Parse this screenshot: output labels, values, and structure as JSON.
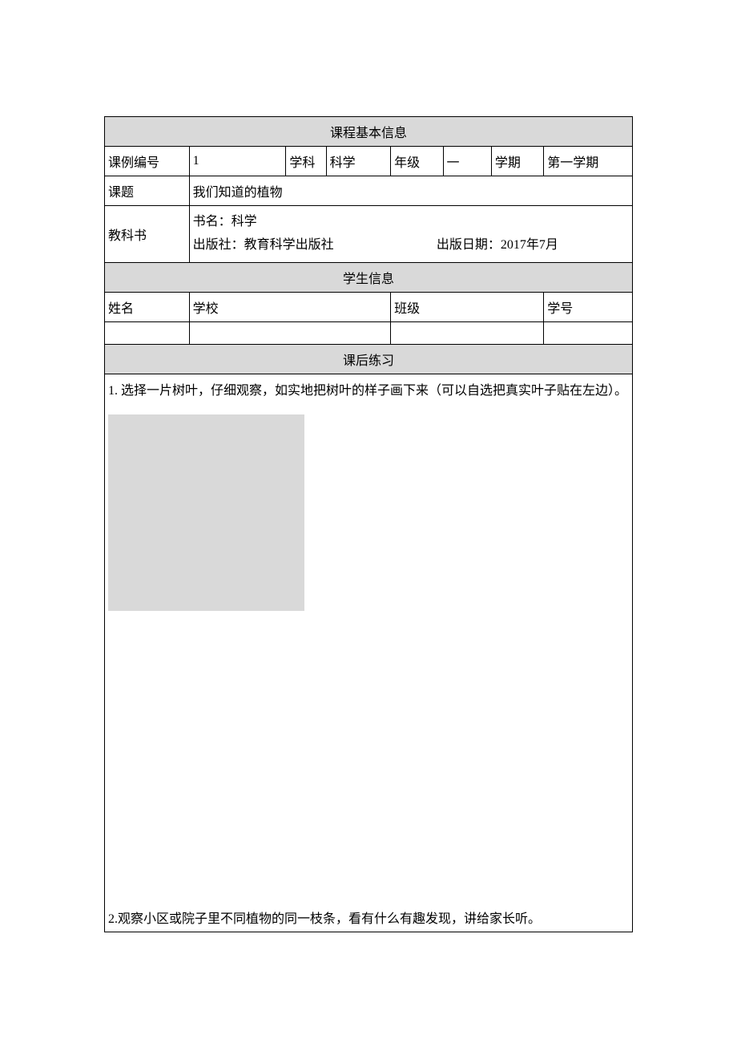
{
  "sections": {
    "course_info": "课程基本信息",
    "student_info": "学生信息",
    "exercise": "课后练习"
  },
  "course": {
    "id_label": "课例编号",
    "id_value": "1",
    "subject_label": "学科",
    "subject_value": "科学",
    "grade_label": "年级",
    "grade_value": "一",
    "term_label": "学期",
    "term_value": "第一学期",
    "topic_label": "课题",
    "topic_value": "我们知道的植物",
    "textbook_label": "教科书",
    "textbook_name": "书名：科学",
    "textbook_publisher": "出版社：教育科学出版社",
    "textbook_date": "出版日期：2017年7月"
  },
  "student": {
    "name_label": "姓名",
    "school_label": "学校",
    "class_label": "班级",
    "number_label": "学号"
  },
  "exercise": {
    "q1": "1. 选择一片树叶，仔细观察，如实地把树叶的样子画下来（可以自选把真实叶子贴在左边）。",
    "q2": "2.观察小区或院子里不同植物的同一枝条，看有什么有趣发现，讲给家长听。"
  }
}
